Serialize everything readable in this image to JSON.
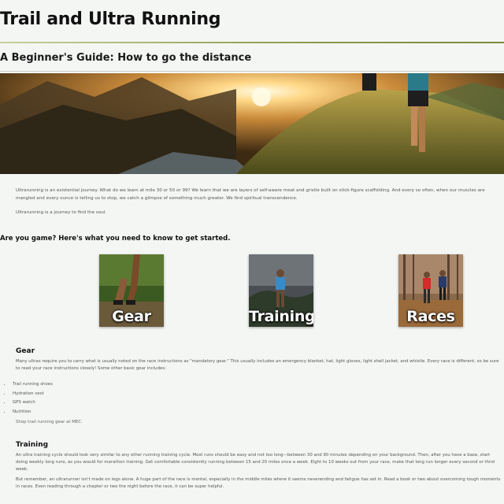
{
  "header": {
    "site_title": "Trail and Ultra Running",
    "subtitle": "A Beginner's Guide: How to go the distance"
  },
  "intro": {
    "paragraph1": "Ultrarunning is an existential journey. What do we learn at mile 30 or 50 or 99? We learn that we are layers of self-aware meat and gristle built on stick-figure scaffolding. And every so often, when our muscles are mangled and every ounce is telling us to stop, we catch a glimpse of something much greater. We find spiritual transcendence.",
    "paragraph2": "Ultrarunning is a journey to find the soul."
  },
  "get_started": {
    "heading": "Are you game? Here's what you need to know to get started.",
    "tiles": [
      {
        "label": "Gear"
      },
      {
        "label": "Training"
      },
      {
        "label": "Races"
      }
    ]
  },
  "gear": {
    "heading": "Gear",
    "paragraph": "Many ultras require you to carry what is usually noted on the race instructions as \"mandatory gear.\" This usually includes an emergency blanket, hat, light gloves, light shell jacket, and whistle. Every race is different, so be sure to read your race instructions closely! Some other basic gear includes:",
    "items": [
      "Trail running shoes",
      "Hydration vest",
      "GPS watch",
      "Nutrition"
    ],
    "link": "Shop trail running gear at MEC."
  },
  "training": {
    "heading": "Training",
    "paragraph1": "An ultra training cycle should look very similar to any other running training cycle. Most runs should be easy and not too long—between 30 and 90 minutes depending on your background. Then, after you have a base, start doing weekly long runs, as you would for marathon training. Get comfortable consistently running between 15 and 20 miles once a week. Eight to 10 weeks out from your race, make that long run longer every second or third week.",
    "paragraph2": "But remember, an ultrarunner isn't made on legs alone. A huge part of the race is mental, especially in the middle miles where it seems neverending and fatigue has set in. Read a book or two about overcoming tough moments in races. Even reading through a chapter or two the night before the race, it can be super helpful."
  }
}
